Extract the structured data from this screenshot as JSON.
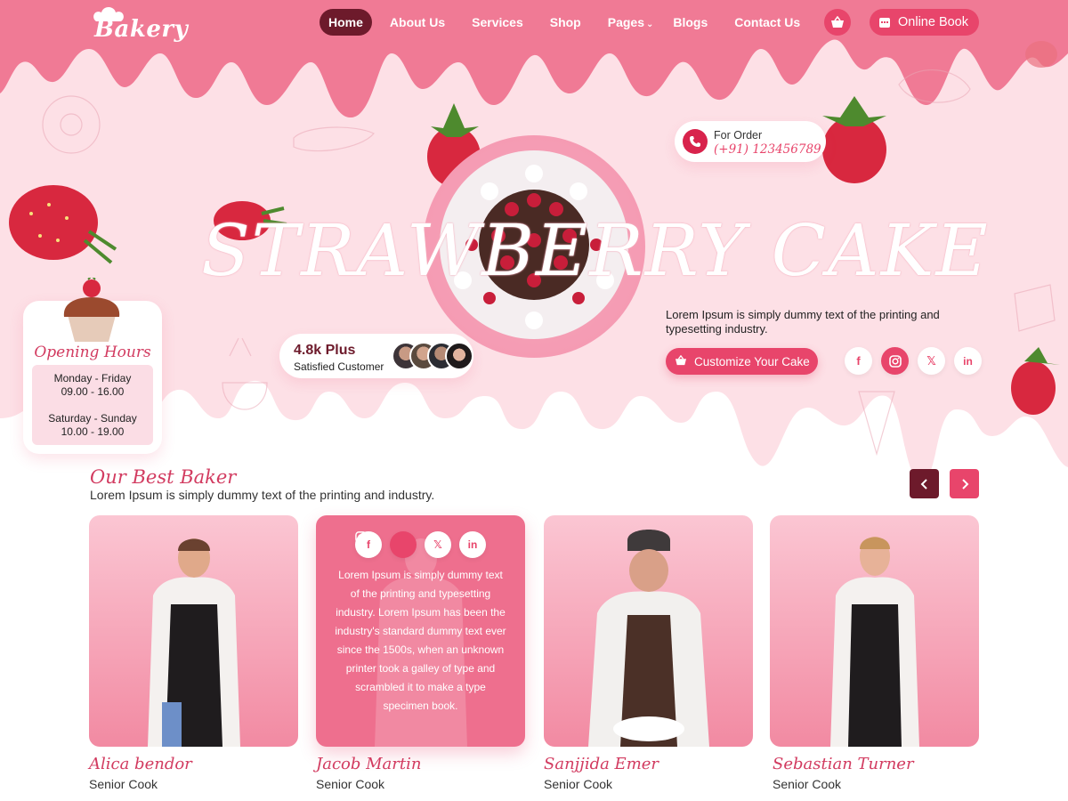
{
  "brand": {
    "logo_text": "Bakery"
  },
  "nav": {
    "items": [
      {
        "label": "Home",
        "active": true
      },
      {
        "label": "About Us"
      },
      {
        "label": "Services"
      },
      {
        "label": "Shop"
      },
      {
        "label": "Pages"
      },
      {
        "label": "Blogs"
      },
      {
        "label": "Contact Us"
      }
    ],
    "cart_icon": "basket-icon",
    "book_label": "Online Book",
    "book_icon": "calendar-icon"
  },
  "hero": {
    "title": "STRAWBERRY CAKE",
    "order_label": "For Order",
    "order_phone": "(+91) 123456789",
    "description": "Lorem Ipsum is simply dummy text of the printing and typesetting industry.",
    "customize_label": "Customize Your Cake",
    "satisfied_count": "4.8k Plus",
    "satisfied_label": "Satisfied Customer",
    "socials": [
      "f",
      "ig",
      "x",
      "in"
    ]
  },
  "hours": {
    "title": "Opening Hours",
    "weekday_days": "Monday - Friday",
    "weekday_time": "09.00 - 16.00",
    "weekend_days": "Saturday - Sunday",
    "weekend_time": "10.00 - 19.00"
  },
  "bakers": {
    "title": "Our Best Baker",
    "subtitle": "Lorem Ipsum is simply dummy text of the printing and industry.",
    "overlay_bio": "Lorem Ipsum is simply dummy text of the printing and typesetting industry. Lorem Ipsum has been the industry's standard dummy text ever since the 1500s, when an unknown printer took a galley of type and scrambled it to make a type specimen book.",
    "members": [
      {
        "name": "Alica bendor",
        "role": "Senior Cook"
      },
      {
        "name": "Jacob Martin",
        "role": "Senior Cook"
      },
      {
        "name": "Sanjjida Emer",
        "role": "Senior Cook"
      },
      {
        "name": "Sebastian Turner",
        "role": "Senior Cook"
      }
    ]
  },
  "colors": {
    "accent": "#e8456b",
    "dark": "#6d1a2b",
    "hero_pink": "#fde0e6",
    "drip": "#f07a95"
  }
}
